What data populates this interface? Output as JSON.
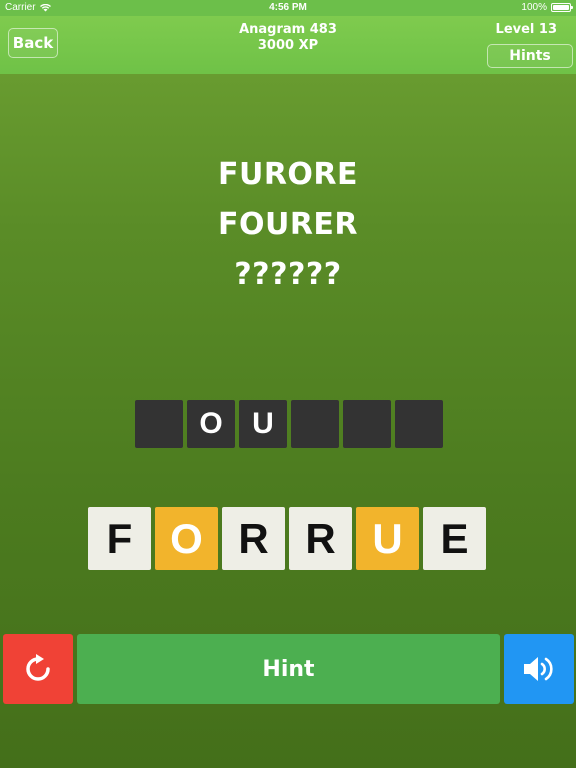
{
  "status_bar": {
    "carrier": "Carrier",
    "time": "4:56 PM",
    "battery": "100%"
  },
  "header": {
    "back_label": "Back",
    "puzzle_title": "Anagram 483",
    "xp": "3000 XP",
    "level": "Level 13",
    "hints_label": "Hints"
  },
  "clues": [
    "FURORE",
    "FOURER",
    "??????"
  ],
  "answer_slots": [
    "",
    "O",
    "U",
    "",
    "",
    ""
  ],
  "letter_tiles": [
    {
      "letter": "F",
      "state": "available"
    },
    {
      "letter": "O",
      "state": "used"
    },
    {
      "letter": "R",
      "state": "available"
    },
    {
      "letter": "R",
      "state": "available"
    },
    {
      "letter": "U",
      "state": "used"
    },
    {
      "letter": "E",
      "state": "available"
    }
  ],
  "footer": {
    "reset_icon": "refresh-icon",
    "hint_label": "Hint",
    "sound_icon": "speaker-icon"
  },
  "colors": {
    "top_bar": "#6fc247",
    "slot_bg": "#333333",
    "tile_bg": "#eeeee6",
    "tile_used": "#f2b42c",
    "reset": "#f04236",
    "hint": "#4caf50",
    "sound": "#2196f3"
  }
}
